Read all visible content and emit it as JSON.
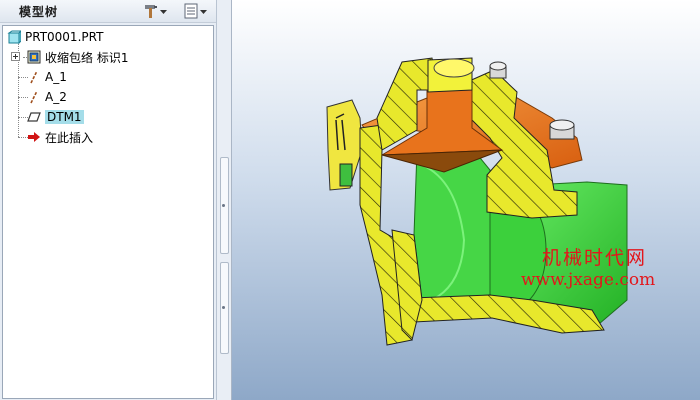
{
  "panel": {
    "title": "模型树",
    "tools_icon": "tools-hammer-icon",
    "settings_icon": "tree-settings-icon"
  },
  "tree": {
    "root": {
      "label": "PRT0001.PRT",
      "icon": "part-cube-icon"
    },
    "items": [
      {
        "label": "收缩包络 标识1",
        "icon": "shrinkwrap-feature-icon",
        "expandable": true
      },
      {
        "label": "A_1",
        "icon": "datum-axis-icon"
      },
      {
        "label": "A_2",
        "icon": "datum-axis-icon"
      },
      {
        "label": "DTM1",
        "icon": "datum-plane-icon",
        "selected": true
      },
      {
        "label": "在此插入",
        "icon": "insert-here-arrow-icon"
      }
    ]
  },
  "graphics": {
    "watermark_line1": "机械时代网",
    "watermark_line2": "www.jxage.com",
    "watermark_color": "#e3161b"
  },
  "colors": {
    "section_yellow": "#e6e62a",
    "interior_green": "#3cd03c",
    "cap_orange": "#f07a1e",
    "selection": "#a4dde9"
  }
}
